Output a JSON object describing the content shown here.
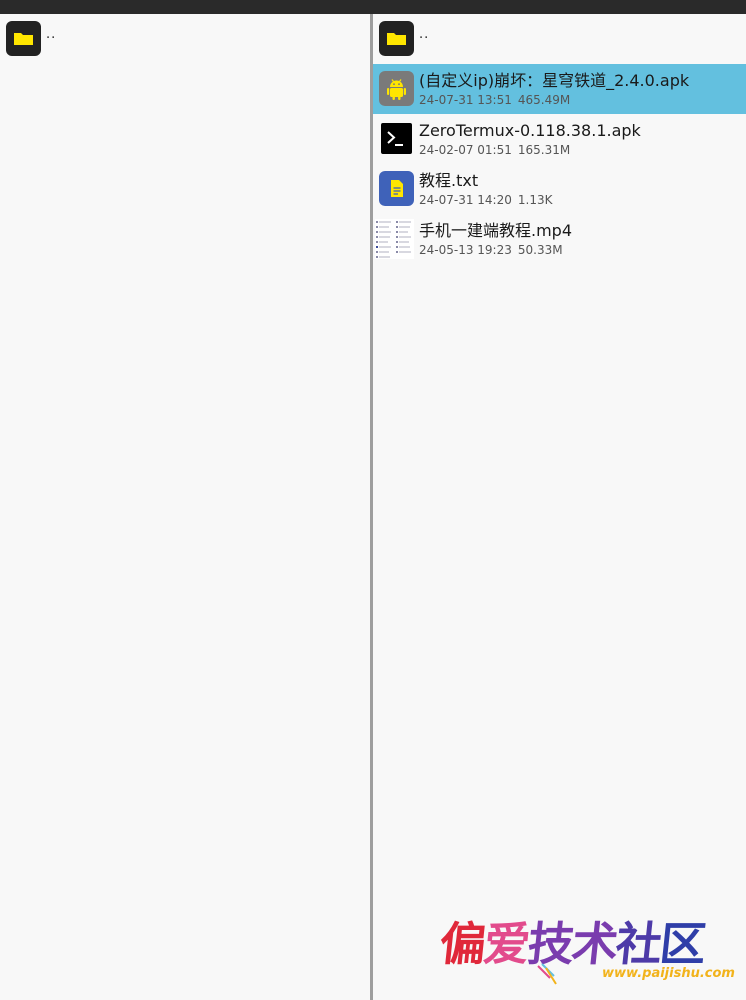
{
  "left_pane": {
    "updir": {
      "label": "..",
      "icon": "folder-icon"
    }
  },
  "right_pane": {
    "updir": {
      "label": "..",
      "icon": "folder-icon"
    },
    "files": [
      {
        "name": "(自定义ip)崩坏：星穹铁道_2.4.0.apk",
        "date": "24-07-31 13:51",
        "size": "465.49M",
        "icon": "android-apk-icon",
        "selected": true
      },
      {
        "name": "ZeroTermux-0.118.38.1.apk",
        "date": "24-02-07 01:51",
        "size": "165.31M",
        "icon": "terminal-icon",
        "selected": false
      },
      {
        "name": "教程.txt",
        "date": "24-07-31 14:20",
        "size": "1.13K",
        "icon": "text-file-icon",
        "selected": false
      },
      {
        "name": "手机一建端教程.mp4",
        "date": "24-05-13 19:23",
        "size": "50.33M",
        "icon": "video-thumbnail",
        "selected": false
      }
    ]
  },
  "watermark": {
    "title_chars": [
      "偏",
      "爱",
      "技",
      "术",
      "社",
      "区"
    ],
    "url": "www.paijishu.com"
  },
  "colors": {
    "selected_row": "#63c0df",
    "folder_icon_bg": "#222222",
    "folder_yellow": "#ffe600",
    "apk_icon_bg": "#7a7a7a",
    "text_icon_bg": "#3f62b9",
    "background": "#f8f8f8",
    "topbar": "#2a2a2a"
  }
}
